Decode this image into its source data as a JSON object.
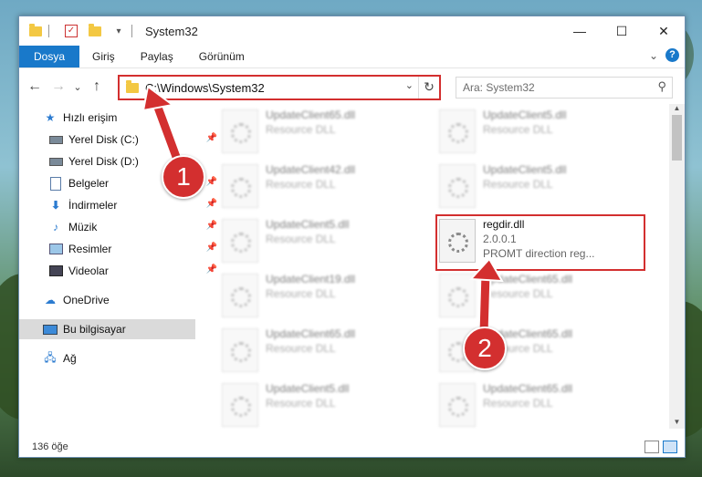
{
  "window": {
    "title": "System32",
    "controls": {
      "minimize": "—",
      "maximize": "☐",
      "close": "✕"
    }
  },
  "ribbon": {
    "tabs": [
      "Dosya",
      "Giriş",
      "Paylaş",
      "Görünüm"
    ],
    "expand": "⌄",
    "help": "?"
  },
  "nav": {
    "back": "←",
    "forward": "→",
    "recent": "⌄",
    "up": "↑"
  },
  "address": {
    "path": "C:\\Windows\\System32",
    "dropdown": "⌄",
    "refresh": "↻"
  },
  "search": {
    "placeholder": "Ara: System32",
    "icon": "search-icon"
  },
  "sidebar": {
    "items": [
      {
        "label": "Hızlı erişim",
        "icon": "star-icon",
        "pinned": false
      },
      {
        "label": "Yerel Disk (C:)",
        "icon": "drive-icon",
        "pinned": true
      },
      {
        "label": "Yerel Disk (D:)",
        "icon": "drive-icon",
        "pinned": false
      },
      {
        "label": "Belgeler",
        "icon": "documents-icon",
        "pinned": true
      },
      {
        "label": "İndirmeler",
        "icon": "download-icon",
        "pinned": true
      },
      {
        "label": "Müzik",
        "icon": "music-icon",
        "pinned": true
      },
      {
        "label": "Resimler",
        "icon": "pictures-icon",
        "pinned": true
      },
      {
        "label": "Videolar",
        "icon": "videos-icon",
        "pinned": true
      },
      {
        "label": "OneDrive",
        "icon": "cloud-icon",
        "pinned": false
      },
      {
        "label": "Bu bilgisayar",
        "icon": "computer-icon",
        "pinned": false
      },
      {
        "label": "Ağ",
        "icon": "network-icon",
        "pinned": false
      }
    ]
  },
  "files": {
    "col1": [
      {
        "name": "UpdateClient65.dll",
        "type": "Resource DLL"
      },
      {
        "name": "UpdateClient42.dll",
        "type": "Resource DLL"
      },
      {
        "name": "UpdateClient5.dll",
        "type": "Resource DLL"
      },
      {
        "name": "UpdateClient19.dll",
        "type": "Resource DLL"
      },
      {
        "name": "UpdateClient65.dll",
        "type": "Resource DLL"
      },
      {
        "name": "UpdateClient5.dll",
        "type": "Resource DLL"
      },
      {
        "name": "UpdateClient65.dll",
        "type": "Resource DLL"
      }
    ],
    "col2": [
      {
        "name": "UpdateClient5.dll",
        "type": "Resource DLL"
      },
      {
        "name": "UpdateClient5.dll",
        "type": "Resource DLL"
      },
      {
        "name": "UpdateClient5.dll",
        "type": "Resource DLL"
      },
      {
        "name": "UpdateClient65.dll",
        "type": "Resource DLL"
      },
      {
        "name": "UpdateClient65.dll",
        "type": "Resource DLL"
      },
      {
        "name": "UpdateClient65.dll",
        "type": "Resource DLL"
      }
    ],
    "highlighted": {
      "name": "regdir.dll",
      "version": "2.0.0.1",
      "description": "PROMT direction reg..."
    }
  },
  "status": {
    "count": "136 öğe"
  },
  "callouts": [
    "1",
    "2"
  ],
  "colors": {
    "accent": "#1979ca",
    "highlight": "#d32f2f"
  }
}
